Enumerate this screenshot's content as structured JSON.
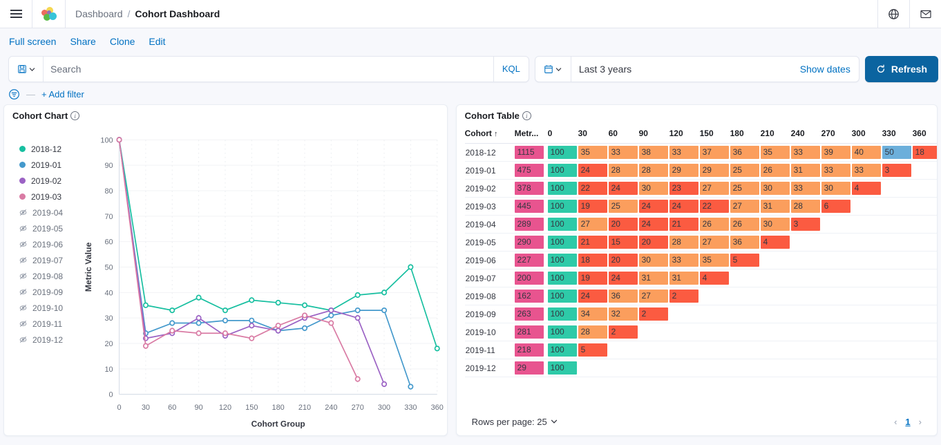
{
  "header": {
    "menu_icon": "hamburger-icon",
    "logo": "kibana-logo",
    "breadcrumb_parent": "Dashboard",
    "breadcrumb_sep": "/",
    "breadcrumb_current": "Cohort Dashboard",
    "globe_icon": "globe-icon",
    "mail_icon": "mail-icon"
  },
  "actions": {
    "full_screen": "Full screen",
    "share": "Share",
    "clone": "Clone",
    "edit": "Edit"
  },
  "query": {
    "saved_query_icon": "saved-query-icon",
    "chevron_icon": "chevron-down-icon",
    "search_placeholder": "Search",
    "search_value": "",
    "kql_label": "KQL",
    "calendar_icon": "calendar-icon",
    "time_range": "Last 3 years",
    "show_dates": "Show dates",
    "refresh_icon": "refresh-icon",
    "refresh_label": "Refresh",
    "refresh_bg": "#0b64a0"
  },
  "filters": {
    "filter_icon": "filter-icon",
    "dash": "—",
    "add_filter": "+ Add filter"
  },
  "chart_panel": {
    "title": "Cohort Chart",
    "info_icon": "info-icon"
  },
  "table_panel": {
    "title": "Cohort Table",
    "info_icon": "info-icon"
  },
  "legend": [
    {
      "label": "2018-12",
      "color": "#17bfa0",
      "visible": true
    },
    {
      "label": "2019-01",
      "color": "#4499cc",
      "visible": true
    },
    {
      "label": "2019-02",
      "color": "#9b62c4",
      "visible": true
    },
    {
      "label": "2019-03",
      "color": "#d97ba4",
      "visible": true
    },
    {
      "label": "2019-04",
      "color": "#98a2b3",
      "visible": false
    },
    {
      "label": "2019-05",
      "color": "#98a2b3",
      "visible": false
    },
    {
      "label": "2019-06",
      "color": "#98a2b3",
      "visible": false
    },
    {
      "label": "2019-07",
      "color": "#98a2b3",
      "visible": false
    },
    {
      "label": "2019-08",
      "color": "#98a2b3",
      "visible": false
    },
    {
      "label": "2019-09",
      "color": "#98a2b3",
      "visible": false
    },
    {
      "label": "2019-10",
      "color": "#98a2b3",
      "visible": false
    },
    {
      "label": "2019-11",
      "color": "#98a2b3",
      "visible": false
    },
    {
      "label": "2019-12",
      "color": "#98a2b3",
      "visible": false
    }
  ],
  "chart_data": {
    "type": "line",
    "title": "Cohort Chart",
    "xlabel": "Cohort Group",
    "ylabel": "Metric Value",
    "x": [
      0,
      30,
      60,
      90,
      120,
      150,
      180,
      210,
      240,
      270,
      300,
      330,
      360
    ],
    "xticks": [
      "0",
      "30",
      "60",
      "90",
      "120",
      "150",
      "180",
      "210",
      "240",
      "270",
      "300",
      "330",
      "360"
    ],
    "yticks": [
      "0",
      "10",
      "20",
      "30",
      "40",
      "50",
      "60",
      "70",
      "80",
      "90",
      "100"
    ],
    "xlim": [
      0,
      360
    ],
    "ylim": [
      0,
      100
    ],
    "grid": true,
    "legend_position": "left",
    "series": [
      {
        "name": "2018-12",
        "color": "#17bfa0",
        "values": [
          100,
          35,
          33,
          38,
          33,
          37,
          36,
          35,
          33,
          39,
          40,
          50,
          18
        ]
      },
      {
        "name": "2019-01",
        "color": "#4499cc",
        "values": [
          100,
          24,
          28,
          28,
          29,
          29,
          25,
          26,
          31,
          33,
          33,
          3,
          null
        ]
      },
      {
        "name": "2019-02",
        "color": "#9b62c4",
        "values": [
          100,
          22,
          24,
          30,
          23,
          27,
          25,
          30,
          33,
          30,
          4,
          null,
          null
        ]
      },
      {
        "name": "2019-03",
        "color": "#d97ba4",
        "values": [
          100,
          19,
          25,
          24,
          24,
          22,
          27,
          31,
          28,
          6,
          null,
          null,
          null
        ]
      }
    ]
  },
  "table": {
    "columns": [
      "Cohort",
      "Metr...",
      "0",
      "30",
      "60",
      "90",
      "120",
      "150",
      "180",
      "210",
      "240",
      "270",
      "300",
      "330",
      "360"
    ],
    "sort_column": "Cohort",
    "sort_icon": "sort-asc-icon",
    "colors": {
      "metric": "#e8548f",
      "baseline": "#2ecaa8",
      "mid": "#fb9e5d",
      "low": "#fb5b41",
      "highlight": "#6cafdb"
    },
    "rows": [
      {
        "cohort": "2018-12",
        "metric": "1115",
        "cells": [
          {
            "v": "100",
            "c": "baseline"
          },
          {
            "v": "35",
            "c": "mid"
          },
          {
            "v": "33",
            "c": "mid"
          },
          {
            "v": "38",
            "c": "mid"
          },
          {
            "v": "33",
            "c": "mid"
          },
          {
            "v": "37",
            "c": "mid"
          },
          {
            "v": "36",
            "c": "mid"
          },
          {
            "v": "35",
            "c": "mid"
          },
          {
            "v": "33",
            "c": "mid"
          },
          {
            "v": "39",
            "c": "mid"
          },
          {
            "v": "40",
            "c": "mid"
          },
          {
            "v": "50",
            "c": "highlight"
          },
          {
            "v": "18",
            "c": "low"
          }
        ]
      },
      {
        "cohort": "2019-01",
        "metric": "475",
        "cells": [
          {
            "v": "100",
            "c": "baseline"
          },
          {
            "v": "24",
            "c": "low"
          },
          {
            "v": "28",
            "c": "mid"
          },
          {
            "v": "28",
            "c": "mid"
          },
          {
            "v": "29",
            "c": "mid"
          },
          {
            "v": "29",
            "c": "mid"
          },
          {
            "v": "25",
            "c": "mid"
          },
          {
            "v": "26",
            "c": "mid"
          },
          {
            "v": "31",
            "c": "mid"
          },
          {
            "v": "33",
            "c": "mid"
          },
          {
            "v": "33",
            "c": "mid"
          },
          {
            "v": "3",
            "c": "low"
          }
        ]
      },
      {
        "cohort": "2019-02",
        "metric": "378",
        "cells": [
          {
            "v": "100",
            "c": "baseline"
          },
          {
            "v": "22",
            "c": "low"
          },
          {
            "v": "24",
            "c": "low"
          },
          {
            "v": "30",
            "c": "mid"
          },
          {
            "v": "23",
            "c": "low"
          },
          {
            "v": "27",
            "c": "mid"
          },
          {
            "v": "25",
            "c": "mid"
          },
          {
            "v": "30",
            "c": "mid"
          },
          {
            "v": "33",
            "c": "mid"
          },
          {
            "v": "30",
            "c": "mid"
          },
          {
            "v": "4",
            "c": "low"
          }
        ]
      },
      {
        "cohort": "2019-03",
        "metric": "445",
        "cells": [
          {
            "v": "100",
            "c": "baseline"
          },
          {
            "v": "19",
            "c": "low"
          },
          {
            "v": "25",
            "c": "mid"
          },
          {
            "v": "24",
            "c": "low"
          },
          {
            "v": "24",
            "c": "low"
          },
          {
            "v": "22",
            "c": "low"
          },
          {
            "v": "27",
            "c": "mid"
          },
          {
            "v": "31",
            "c": "mid"
          },
          {
            "v": "28",
            "c": "mid"
          },
          {
            "v": "6",
            "c": "low"
          }
        ]
      },
      {
        "cohort": "2019-04",
        "metric": "289",
        "cells": [
          {
            "v": "100",
            "c": "baseline"
          },
          {
            "v": "27",
            "c": "mid"
          },
          {
            "v": "20",
            "c": "low"
          },
          {
            "v": "24",
            "c": "low"
          },
          {
            "v": "21",
            "c": "low"
          },
          {
            "v": "26",
            "c": "mid"
          },
          {
            "v": "26",
            "c": "mid"
          },
          {
            "v": "30",
            "c": "mid"
          },
          {
            "v": "3",
            "c": "low"
          }
        ]
      },
      {
        "cohort": "2019-05",
        "metric": "290",
        "cells": [
          {
            "v": "100",
            "c": "baseline"
          },
          {
            "v": "21",
            "c": "low"
          },
          {
            "v": "15",
            "c": "low"
          },
          {
            "v": "20",
            "c": "low"
          },
          {
            "v": "28",
            "c": "mid"
          },
          {
            "v": "27",
            "c": "mid"
          },
          {
            "v": "36",
            "c": "mid"
          },
          {
            "v": "4",
            "c": "low"
          }
        ]
      },
      {
        "cohort": "2019-06",
        "metric": "227",
        "cells": [
          {
            "v": "100",
            "c": "baseline"
          },
          {
            "v": "18",
            "c": "low"
          },
          {
            "v": "20",
            "c": "low"
          },
          {
            "v": "30",
            "c": "mid"
          },
          {
            "v": "33",
            "c": "mid"
          },
          {
            "v": "35",
            "c": "mid"
          },
          {
            "v": "5",
            "c": "low"
          }
        ]
      },
      {
        "cohort": "2019-07",
        "metric": "200",
        "cells": [
          {
            "v": "100",
            "c": "baseline"
          },
          {
            "v": "19",
            "c": "low"
          },
          {
            "v": "24",
            "c": "low"
          },
          {
            "v": "31",
            "c": "mid"
          },
          {
            "v": "31",
            "c": "mid"
          },
          {
            "v": "4",
            "c": "low"
          }
        ]
      },
      {
        "cohort": "2019-08",
        "metric": "162",
        "cells": [
          {
            "v": "100",
            "c": "baseline"
          },
          {
            "v": "24",
            "c": "low"
          },
          {
            "v": "36",
            "c": "mid"
          },
          {
            "v": "27",
            "c": "mid"
          },
          {
            "v": "2",
            "c": "low"
          }
        ]
      },
      {
        "cohort": "2019-09",
        "metric": "263",
        "cells": [
          {
            "v": "100",
            "c": "baseline"
          },
          {
            "v": "34",
            "c": "mid"
          },
          {
            "v": "32",
            "c": "mid"
          },
          {
            "v": "2",
            "c": "low"
          }
        ]
      },
      {
        "cohort": "2019-10",
        "metric": "281",
        "cells": [
          {
            "v": "100",
            "c": "baseline"
          },
          {
            "v": "28",
            "c": "mid"
          },
          {
            "v": "2",
            "c": "low"
          }
        ]
      },
      {
        "cohort": "2019-11",
        "metric": "218",
        "cells": [
          {
            "v": "100",
            "c": "baseline"
          },
          {
            "v": "5",
            "c": "low"
          }
        ]
      },
      {
        "cohort": "2019-12",
        "metric": "29",
        "cells": [
          {
            "v": "100",
            "c": "baseline"
          }
        ]
      }
    ],
    "footer": {
      "rows_per_page_label": "Rows per page: 25",
      "chevron_icon": "chevron-down-icon",
      "prev_icon": "chevron-left-icon",
      "page_number": "1",
      "next_icon": "chevron-right-icon"
    }
  }
}
